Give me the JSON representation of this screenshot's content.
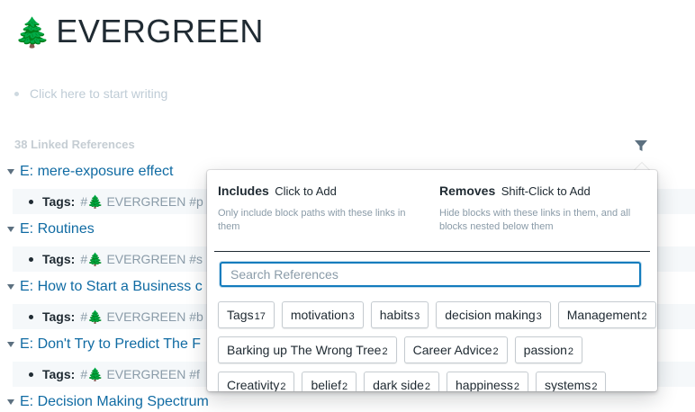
{
  "page": {
    "emoji": "🌲",
    "title": "EVERGREEN",
    "placeholder": "Click here to start writing"
  },
  "references": {
    "count_label": "38 Linked References",
    "items": [
      {
        "title": "E: mere-exposure effect",
        "attr": "Tags:",
        "tag_emoji": "🌲",
        "tag_text": "EVERGREEN #p"
      },
      {
        "title": "E: Routines",
        "attr": "Tags:",
        "tag_emoji": "🌲",
        "tag_text": "EVERGREEN #s"
      },
      {
        "title": "E: How to Start a Business c",
        "attr": "Tags:",
        "tag_emoji": "🌲",
        "tag_text": "EVERGREEN #b"
      },
      {
        "title": "E: Don't Try to Predict The F",
        "attr": "Tags:",
        "tag_emoji": "🌲",
        "tag_text": "EVERGREEN #f"
      },
      {
        "title": "E: Decision Making Spectrum"
      }
    ]
  },
  "filter": {
    "icon": "filter-icon",
    "includes": {
      "title": "Includes",
      "hint": "Click to Add",
      "desc": "Only include block paths with these links in them"
    },
    "removes": {
      "title": "Removes",
      "hint": "Shift-Click to Add",
      "desc": "Hide blocks with these links in them, and all blocks nested below them"
    },
    "search_placeholder": "Search References",
    "chip_rows": [
      [
        {
          "label": "Tags",
          "count": "17"
        },
        {
          "label": "motivation",
          "count": "3"
        },
        {
          "label": "habits",
          "count": "3"
        },
        {
          "label": "decision making",
          "count": "3"
        },
        {
          "label": "Management",
          "count": "2"
        }
      ],
      [
        {
          "label": "Barking up The Wrong Tree",
          "count": "2"
        },
        {
          "label": "Career Advice",
          "count": "2"
        },
        {
          "label": "passion",
          "count": "2"
        }
      ],
      [
        {
          "label": "Creativity",
          "count": "2"
        },
        {
          "label": "belief",
          "count": "2"
        },
        {
          "label": "dark side",
          "count": "2"
        },
        {
          "label": "happiness",
          "count": "2"
        },
        {
          "label": "systems",
          "count": "2"
        }
      ]
    ]
  }
}
